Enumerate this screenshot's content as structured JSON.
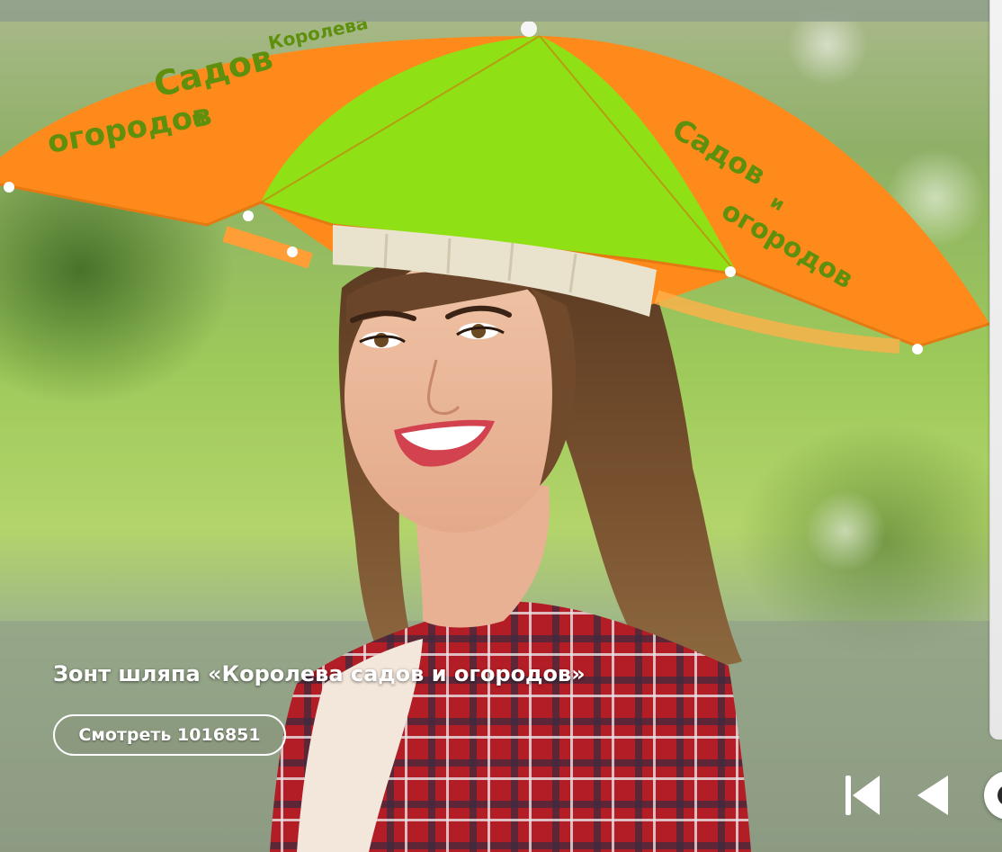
{
  "slide": {
    "caption": "Зонт шляпа «Королева садов и огородов»",
    "button_label": "Смотреть 1016851",
    "umbrella_print": [
      "Королева",
      "садов",
      "и",
      "огородов"
    ]
  },
  "controls": {
    "first_icon": "skip-to-first-icon",
    "prev_icon": "previous-icon",
    "play_icon": "play-circle-icon"
  },
  "colors": {
    "umbrella_orange": "#ff8a1c",
    "umbrella_green": "#8fe014",
    "print_green": "#5e8f0d",
    "text": "#ffffff"
  }
}
